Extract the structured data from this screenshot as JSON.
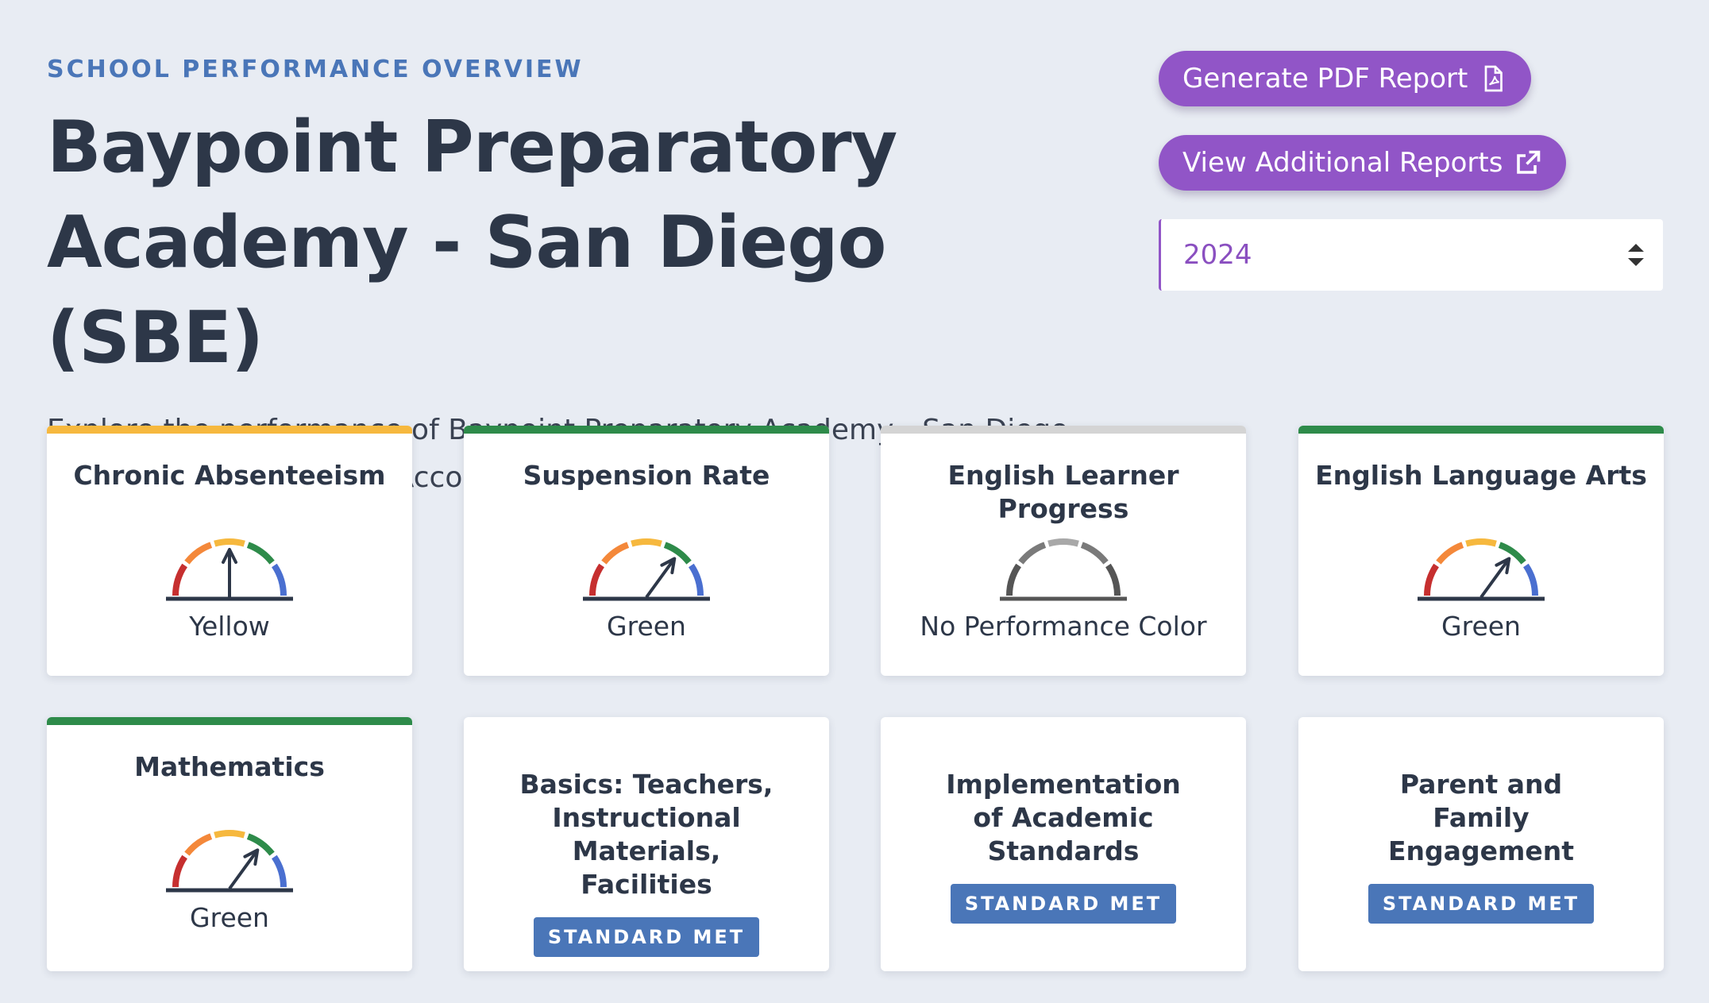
{
  "header": {
    "eyebrow": "SCHOOL PERFORMANCE OVERVIEW",
    "title_line1": "Baypoint Preparatory",
    "title_line2": "Academy - San Diego (SBE)",
    "subtitle": "Explore the performance of Baypoint Preparatory Academy - San Diego (SBE) under California's Accountability System."
  },
  "actions": {
    "pdf_label": "Generate PDF Report",
    "pdf_icon": "pdf-file-icon",
    "reports_label": "View Additional Reports",
    "reports_icon": "external-link-icon",
    "year_selected": "2024"
  },
  "colors": {
    "red": "#c62f2f",
    "orange": "#f4883a",
    "yellow": "#f6b83e",
    "green": "#2e8b4a",
    "blue": "#4a6fd0",
    "gray": "#d4d4d4",
    "accent_purple": "#9155c7",
    "badge_blue": "#4a76b8"
  },
  "indicators": [
    {
      "title": "Chronic Absenteeism",
      "status": "Yellow",
      "level": 3,
      "bar_color": "#f6b83e"
    },
    {
      "title": "Suspension Rate",
      "status": "Green",
      "level": 4,
      "bar_color": "#2e8b4a"
    },
    {
      "title": "English Learner Progress",
      "status": "No Performance Color",
      "level": 0,
      "bar_color": "#d4d4d4"
    },
    {
      "title": "English Language Arts",
      "status": "Green",
      "level": 4,
      "bar_color": "#2e8b4a"
    },
    {
      "title": "Mathematics",
      "status": "Green",
      "level": 4,
      "bar_color": "#2e8b4a"
    }
  ],
  "local_indicators": [
    {
      "title": "Basics: Teachers, Instructional Materials, Facilities",
      "badge": "STANDARD MET"
    },
    {
      "title": "Implementation of Academic Standards",
      "badge": "STANDARD MET"
    },
    {
      "title": "Parent and Family Engagement",
      "badge": "STANDARD MET"
    }
  ]
}
